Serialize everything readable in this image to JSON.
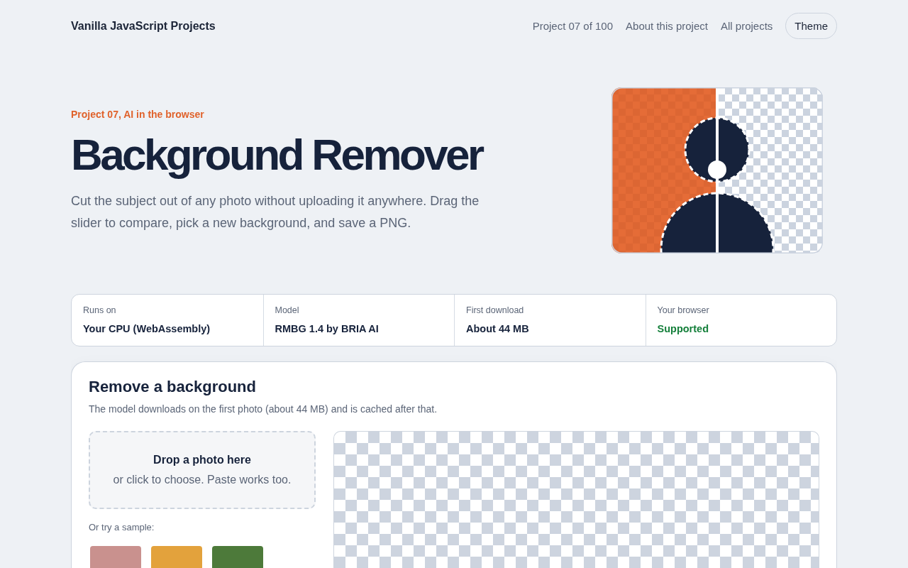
{
  "header": {
    "title": "Vanilla JavaScript Projects",
    "project_counter": "Project 07 of 100",
    "links": [
      "About this project",
      "All projects"
    ],
    "theme_button": "Theme"
  },
  "hero": {
    "eyebrow": "Project 07, AI in the browser",
    "title": "Background Remover",
    "lead": "Cut the subject out of any photo without uploading it anywhere. Drag the slider to compare, pick a new background, and save a PNG."
  },
  "facts": [
    {
      "label": "Runs on",
      "value": "Your CPU (WebAssembly)",
      "kind": "plain"
    },
    {
      "label": "Model",
      "value": "RMBG 1.4 by BRIA AI",
      "kind": "plain"
    },
    {
      "label": "First download",
      "value": "About 44 MB",
      "kind": "plain"
    },
    {
      "label": "Your browser",
      "value": "Supported",
      "kind": "status"
    }
  ],
  "tool": {
    "title": "Remove a background",
    "subtitle": "The model downloads on the first photo (about 44 MB) and is cached after that.",
    "dropzone": {
      "title": "Drop a photo here",
      "hint": "or click to choose. Paste works too."
    },
    "samples_label": "Or try a sample:",
    "samples": [
      {
        "color": "#c9918e"
      },
      {
        "color": "#e3a23c"
      },
      {
        "color": "#4d7a3a"
      }
    ]
  }
}
